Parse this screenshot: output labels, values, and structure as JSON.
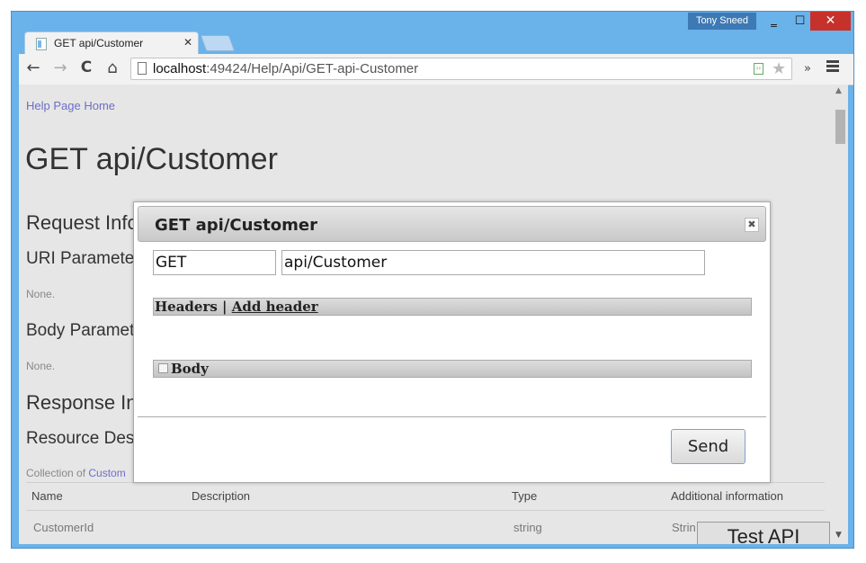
{
  "window": {
    "user_name": "Tony Sneed",
    "minimize_glyph": "‗",
    "maximize_glyph": "☐",
    "close_glyph": "✕"
  },
  "tab": {
    "title": "GET api/Customer",
    "close_glyph": "✕"
  },
  "toolbar": {
    "url_host": "localhost",
    "url_path": ":49424/Help/Api/GET-api-Customer",
    "back_glyph": "←",
    "forward_glyph": "→",
    "reload_glyph": "C",
    "home_glyph": "⌂",
    "more_glyph": "»",
    "star_glyph": "★",
    "reader_glyph": "‹›"
  },
  "page": {
    "help_link": "Help Page Home",
    "title": "GET api/Customer",
    "request_info": "Request Info",
    "uri_parameters": "URI Parameters",
    "uri_none": "None.",
    "body_parameters": "Body Parameters",
    "body_none": "None.",
    "response_info": "Response Info",
    "resource_desc": "Resource Desc",
    "collection_of": "Collection of ",
    "collection_link": "Custom",
    "table": {
      "headers": [
        "Name",
        "Description",
        "Type",
        "Additional information"
      ],
      "rows": [
        {
          "name": "CustomerId",
          "description": "",
          "type": "string",
          "additional": "Strin"
        }
      ]
    }
  },
  "test_api_label": "Test API",
  "dialog": {
    "title": "GET api/Customer",
    "close_glyph": "✖",
    "method_value": "GET",
    "uri_value": "api/Customer",
    "headers_label": "Headers",
    "headers_separator": " | ",
    "add_header_label": "Add header",
    "body_label": "Body",
    "send_label": "Send"
  },
  "colors": {
    "window_frame": "#6ab2ea",
    "close_button": "#c7312b",
    "link": "#6d6dc9",
    "page_background": "#e6e6e6"
  }
}
